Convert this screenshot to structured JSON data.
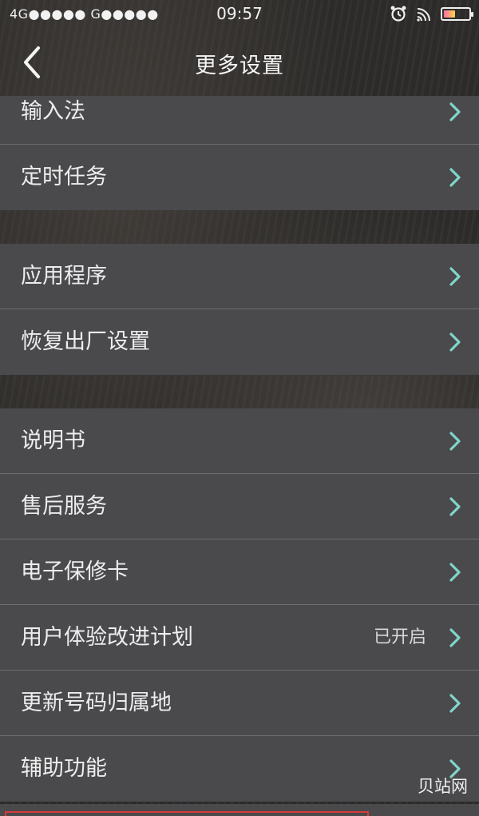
{
  "status_bar": {
    "network": "4G●●●●● G●●●●●",
    "time": "09:57",
    "battery_level": 0.45
  },
  "header": {
    "title": "更多设置"
  },
  "groups": [
    {
      "items": [
        {
          "label": "输入法"
        },
        {
          "label": "定时任务"
        }
      ]
    },
    {
      "items": [
        {
          "label": "应用程序"
        },
        {
          "label": "恢复出厂设置"
        }
      ]
    },
    {
      "items": [
        {
          "label": "说明书"
        },
        {
          "label": "售后服务"
        },
        {
          "label": "电子保修卡"
        },
        {
          "label": "用户体验改进计划",
          "value": "已开启"
        },
        {
          "label": "更新号码归属地"
        },
        {
          "label": "辅助功能"
        }
      ]
    }
  ],
  "watermark": "贝站网",
  "colors": {
    "chevron": "#7fd6c8",
    "row_bg": "#4a494c",
    "highlight": "#d63a3a"
  }
}
